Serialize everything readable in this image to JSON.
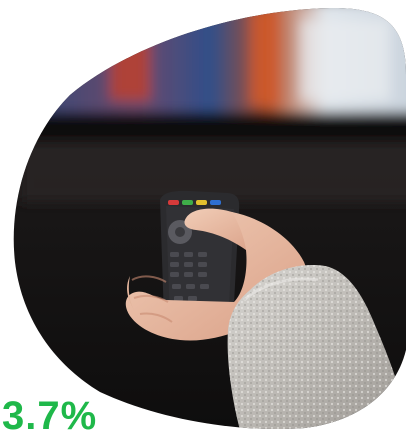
{
  "stat": {
    "value": "3.7%",
    "color": "#1fb84a"
  },
  "photo": {
    "subject": "hand-holding-tv-remote-photo"
  }
}
